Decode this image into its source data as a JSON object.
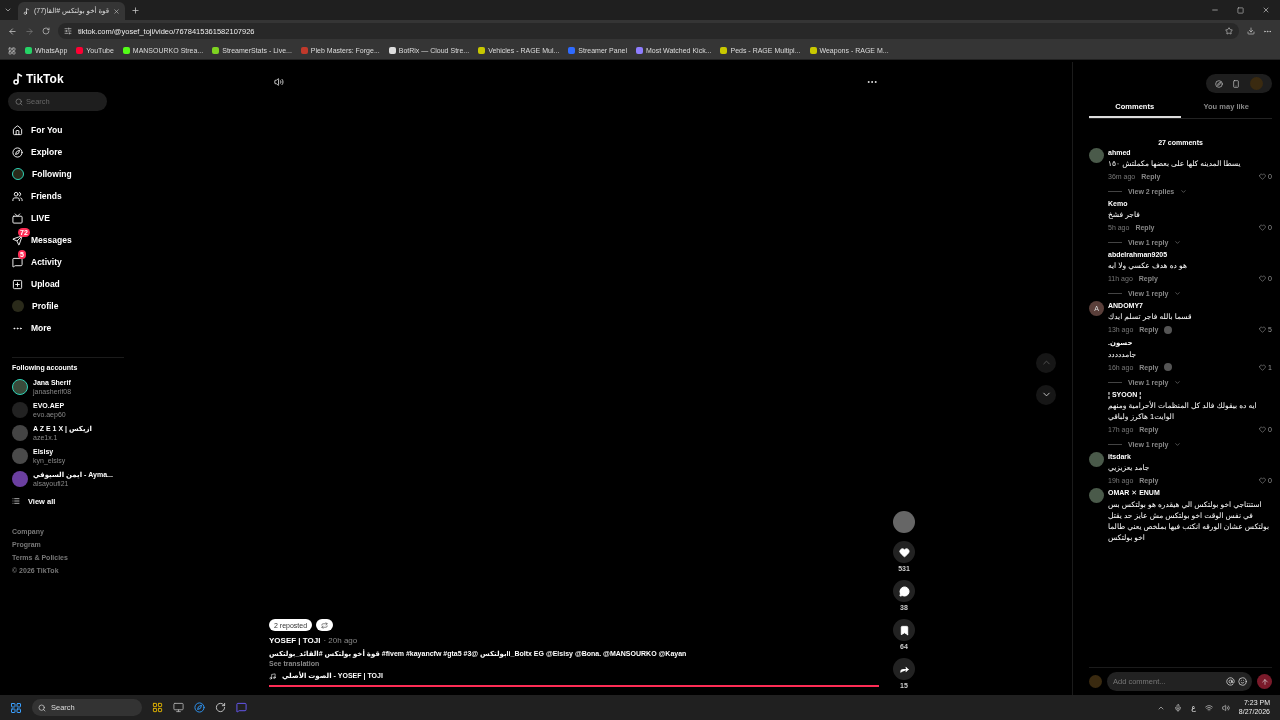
{
  "browser": {
    "tab": {
      "title": "(77)قوة أخو بولتكس #القا",
      "selected": true
    },
    "url": "tiktok.com/@yosef_toji/video/7678415361582107926",
    "bookmarks": [
      {
        "label": "WhatsApp",
        "color": "#25d366"
      },
      {
        "label": "YouTube",
        "color": "#ff0033"
      },
      {
        "label": "MANSOURKO Strea...",
        "color": "#53fc18"
      },
      {
        "label": "StreamerStats - Live...",
        "color": "#7ed321"
      },
      {
        "label": "Pleb Masters: Forge...",
        "color": "#c0392b"
      },
      {
        "label": "BotRix — Cloud Stre...",
        "color": "#dddddd"
      },
      {
        "label": "Vehicles - RAGE Mul...",
        "color": "#c8c800"
      },
      {
        "label": "Streamer Panel",
        "color": "#2f6bff"
      },
      {
        "label": "Most Watched Kick...",
        "color": "#8e7dff"
      },
      {
        "label": "Peds - RAGE Multipl...",
        "color": "#c8c800"
      },
      {
        "label": "Weapons - RAGE M...",
        "color": "#c8c800"
      }
    ]
  },
  "sidebar": {
    "logo": "TikTok",
    "search": {
      "placeholder": "Search"
    },
    "nav": [
      {
        "label": "For You",
        "selected": false
      },
      {
        "label": "Explore",
        "selected": false
      },
      {
        "label": "Following",
        "selected": false
      },
      {
        "label": "Friends",
        "selected": false
      },
      {
        "label": "LIVE",
        "selected": false
      },
      {
        "label": "Messages",
        "selected": false,
        "badge": "72"
      },
      {
        "label": "Activity",
        "selected": false,
        "badge": "5"
      },
      {
        "label": "Upload",
        "selected": false
      },
      {
        "label": "Profile",
        "selected": false
      },
      {
        "label": "More",
        "selected": false
      }
    ],
    "following_title": "Following accounts",
    "accounts": [
      {
        "name": "Jana Sherif",
        "handle": "janasherif08"
      },
      {
        "name": "EVO.AEP",
        "handle": "evo.aep60"
      },
      {
        "name": "A Z E 1 X | ازيكس",
        "handle": "aze1x.1"
      },
      {
        "name": "Elsisy",
        "handle": "kyn_elsisy"
      },
      {
        "name": "ايمن السيوفي - Ayma...",
        "handle": "alsayoufi21"
      }
    ],
    "view_all": "View all",
    "footer": [
      "Company",
      "Program",
      "Terms & Policies",
      "© 2026 TikTok"
    ]
  },
  "video": {
    "reposted": "2 reposted",
    "author": "YOSEF | TOJI",
    "time": "· 20h ago",
    "caption": "قوة أخو بولتكس #القائد_بولتكس #fivem #kayancfw #gta5 #بولتكس @3li_Boltx EG @Elsisy @Bona. @MANSOURKO @Kayan",
    "see_translation": "See translation",
    "sound": "الصوت الأصلي - YOSEF | TOJI",
    "level": 1,
    "actions": [
      {
        "kind": "like",
        "count": "531"
      },
      {
        "kind": "comment",
        "count": "38"
      },
      {
        "kind": "save",
        "count": "64"
      },
      {
        "kind": "share",
        "count": "15"
      }
    ]
  },
  "panel": {
    "tabs": [
      {
        "label": "Comments",
        "selected": true
      },
      {
        "label": "You may like",
        "selected": false
      }
    ],
    "count": "27 comments",
    "comments": [
      {
        "author": "ahmed",
        "avatar": true,
        "text": "يسطا المدينه كلها على بعضها مكملتش ١٥٠",
        "time": "36m ago",
        "reply": "Reply",
        "likes": "0",
        "creator_liked": false,
        "replies": "View 2 replies"
      },
      {
        "author": "Kemo",
        "avatar": false,
        "text": "فاجر فشخ",
        "time": "5h ago",
        "reply": "Reply",
        "likes": "0",
        "creator_liked": false,
        "replies": "View 1 reply"
      },
      {
        "author": "abdelrahman9205",
        "avatar": false,
        "text": "هو ده هدف عكسي ولا ايه",
        "time": "11h ago",
        "reply": "Reply",
        "likes": "0",
        "creator_liked": false,
        "replies": "View 1 reply"
      },
      {
        "author": "ANDOMY7",
        "avatar": true,
        "avatar_letter": "A",
        "text": "قسما بالله فاجر تسلم ايدك",
        "time": "13h ago",
        "reply": "Reply",
        "likes": "5",
        "creator_liked": true
      },
      {
        "author": ".حسون",
        "avatar": false,
        "text": "جامددددد",
        "time": "16h ago",
        "reply": "Reply",
        "likes": "1",
        "creator_liked": true,
        "replies": "View 1 reply"
      },
      {
        "author": "¦ SYOON ¦",
        "avatar": false,
        "text": "ايه ده بيقولك فالد كل المنظمات الأحرامية ومنهم الوايت1 هاكرز ولباقي",
        "time": "17h ago",
        "reply": "Reply",
        "likes": "0",
        "creator_liked": false,
        "replies": "View 1 reply"
      },
      {
        "author": "itsdark",
        "avatar": true,
        "text": "جامد يعزيزيي",
        "time": "19h ago",
        "reply": "Reply",
        "likes": "0",
        "creator_liked": false
      },
      {
        "author": "OMAR ✕ ENUM",
        "avatar": true,
        "text": "استنتاجي اخو بولتكس الي هيقدره هو بولتكس بس في نفس الوقت اخو بولتكس مش عايز حد يقتل بولتكس عشان الورقه انكتب فيها بملخص يعني طالما اخو بولتكس"
      }
    ],
    "input": {
      "placeholder": "Add comment..."
    }
  },
  "taskbar": {
    "search": "Search",
    "language": "ع",
    "time": "7:23 PM",
    "date": "8/27/2026"
  }
}
